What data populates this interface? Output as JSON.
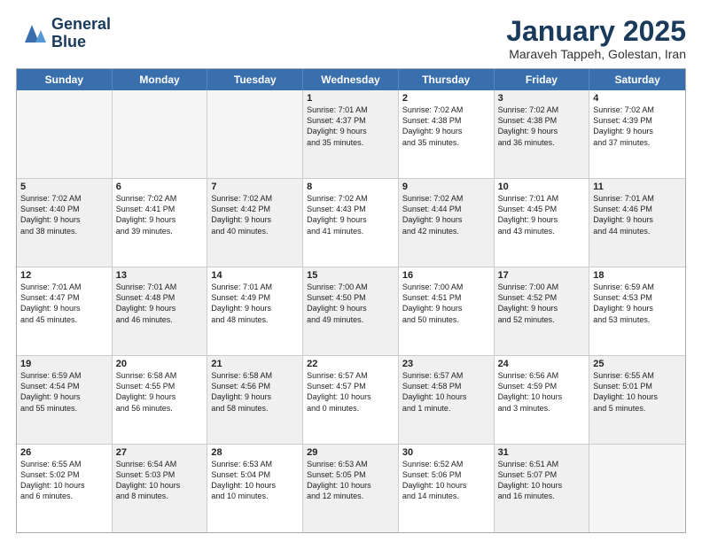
{
  "logo": {
    "line1": "General",
    "line2": "Blue"
  },
  "title": "January 2025",
  "subtitle": "Maraveh Tappeh, Golestan, Iran",
  "weekdays": [
    "Sunday",
    "Monday",
    "Tuesday",
    "Wednesday",
    "Thursday",
    "Friday",
    "Saturday"
  ],
  "rows": [
    [
      {
        "day": "",
        "info": "",
        "empty": true
      },
      {
        "day": "",
        "info": "",
        "empty": true
      },
      {
        "day": "",
        "info": "",
        "empty": true
      },
      {
        "day": "1",
        "info": "Sunrise: 7:01 AM\nSunset: 4:37 PM\nDaylight: 9 hours\nand 35 minutes.",
        "shaded": true
      },
      {
        "day": "2",
        "info": "Sunrise: 7:02 AM\nSunset: 4:38 PM\nDaylight: 9 hours\nand 35 minutes.",
        "shaded": false
      },
      {
        "day": "3",
        "info": "Sunrise: 7:02 AM\nSunset: 4:38 PM\nDaylight: 9 hours\nand 36 minutes.",
        "shaded": true
      },
      {
        "day": "4",
        "info": "Sunrise: 7:02 AM\nSunset: 4:39 PM\nDaylight: 9 hours\nand 37 minutes.",
        "shaded": false
      }
    ],
    [
      {
        "day": "5",
        "info": "Sunrise: 7:02 AM\nSunset: 4:40 PM\nDaylight: 9 hours\nand 38 minutes.",
        "shaded": true
      },
      {
        "day": "6",
        "info": "Sunrise: 7:02 AM\nSunset: 4:41 PM\nDaylight: 9 hours\nand 39 minutes.",
        "shaded": false
      },
      {
        "day": "7",
        "info": "Sunrise: 7:02 AM\nSunset: 4:42 PM\nDaylight: 9 hours\nand 40 minutes.",
        "shaded": true
      },
      {
        "day": "8",
        "info": "Sunrise: 7:02 AM\nSunset: 4:43 PM\nDaylight: 9 hours\nand 41 minutes.",
        "shaded": false
      },
      {
        "day": "9",
        "info": "Sunrise: 7:02 AM\nSunset: 4:44 PM\nDaylight: 9 hours\nand 42 minutes.",
        "shaded": true
      },
      {
        "day": "10",
        "info": "Sunrise: 7:01 AM\nSunset: 4:45 PM\nDaylight: 9 hours\nand 43 minutes.",
        "shaded": false
      },
      {
        "day": "11",
        "info": "Sunrise: 7:01 AM\nSunset: 4:46 PM\nDaylight: 9 hours\nand 44 minutes.",
        "shaded": true
      }
    ],
    [
      {
        "day": "12",
        "info": "Sunrise: 7:01 AM\nSunset: 4:47 PM\nDaylight: 9 hours\nand 45 minutes.",
        "shaded": false
      },
      {
        "day": "13",
        "info": "Sunrise: 7:01 AM\nSunset: 4:48 PM\nDaylight: 9 hours\nand 46 minutes.",
        "shaded": true
      },
      {
        "day": "14",
        "info": "Sunrise: 7:01 AM\nSunset: 4:49 PM\nDaylight: 9 hours\nand 48 minutes.",
        "shaded": false
      },
      {
        "day": "15",
        "info": "Sunrise: 7:00 AM\nSunset: 4:50 PM\nDaylight: 9 hours\nand 49 minutes.",
        "shaded": true
      },
      {
        "day": "16",
        "info": "Sunrise: 7:00 AM\nSunset: 4:51 PM\nDaylight: 9 hours\nand 50 minutes.",
        "shaded": false
      },
      {
        "day": "17",
        "info": "Sunrise: 7:00 AM\nSunset: 4:52 PM\nDaylight: 9 hours\nand 52 minutes.",
        "shaded": true
      },
      {
        "day": "18",
        "info": "Sunrise: 6:59 AM\nSunset: 4:53 PM\nDaylight: 9 hours\nand 53 minutes.",
        "shaded": false
      }
    ],
    [
      {
        "day": "19",
        "info": "Sunrise: 6:59 AM\nSunset: 4:54 PM\nDaylight: 9 hours\nand 55 minutes.",
        "shaded": true
      },
      {
        "day": "20",
        "info": "Sunrise: 6:58 AM\nSunset: 4:55 PM\nDaylight: 9 hours\nand 56 minutes.",
        "shaded": false
      },
      {
        "day": "21",
        "info": "Sunrise: 6:58 AM\nSunset: 4:56 PM\nDaylight: 9 hours\nand 58 minutes.",
        "shaded": true
      },
      {
        "day": "22",
        "info": "Sunrise: 6:57 AM\nSunset: 4:57 PM\nDaylight: 10 hours\nand 0 minutes.",
        "shaded": false
      },
      {
        "day": "23",
        "info": "Sunrise: 6:57 AM\nSunset: 4:58 PM\nDaylight: 10 hours\nand 1 minute.",
        "shaded": true
      },
      {
        "day": "24",
        "info": "Sunrise: 6:56 AM\nSunset: 4:59 PM\nDaylight: 10 hours\nand 3 minutes.",
        "shaded": false
      },
      {
        "day": "25",
        "info": "Sunrise: 6:55 AM\nSunset: 5:01 PM\nDaylight: 10 hours\nand 5 minutes.",
        "shaded": true
      }
    ],
    [
      {
        "day": "26",
        "info": "Sunrise: 6:55 AM\nSunset: 5:02 PM\nDaylight: 10 hours\nand 6 minutes.",
        "shaded": false
      },
      {
        "day": "27",
        "info": "Sunrise: 6:54 AM\nSunset: 5:03 PM\nDaylight: 10 hours\nand 8 minutes.",
        "shaded": true
      },
      {
        "day": "28",
        "info": "Sunrise: 6:53 AM\nSunset: 5:04 PM\nDaylight: 10 hours\nand 10 minutes.",
        "shaded": false
      },
      {
        "day": "29",
        "info": "Sunrise: 6:53 AM\nSunset: 5:05 PM\nDaylight: 10 hours\nand 12 minutes.",
        "shaded": true
      },
      {
        "day": "30",
        "info": "Sunrise: 6:52 AM\nSunset: 5:06 PM\nDaylight: 10 hours\nand 14 minutes.",
        "shaded": false
      },
      {
        "day": "31",
        "info": "Sunrise: 6:51 AM\nSunset: 5:07 PM\nDaylight: 10 hours\nand 16 minutes.",
        "shaded": true
      },
      {
        "day": "",
        "info": "",
        "empty": true
      }
    ]
  ]
}
